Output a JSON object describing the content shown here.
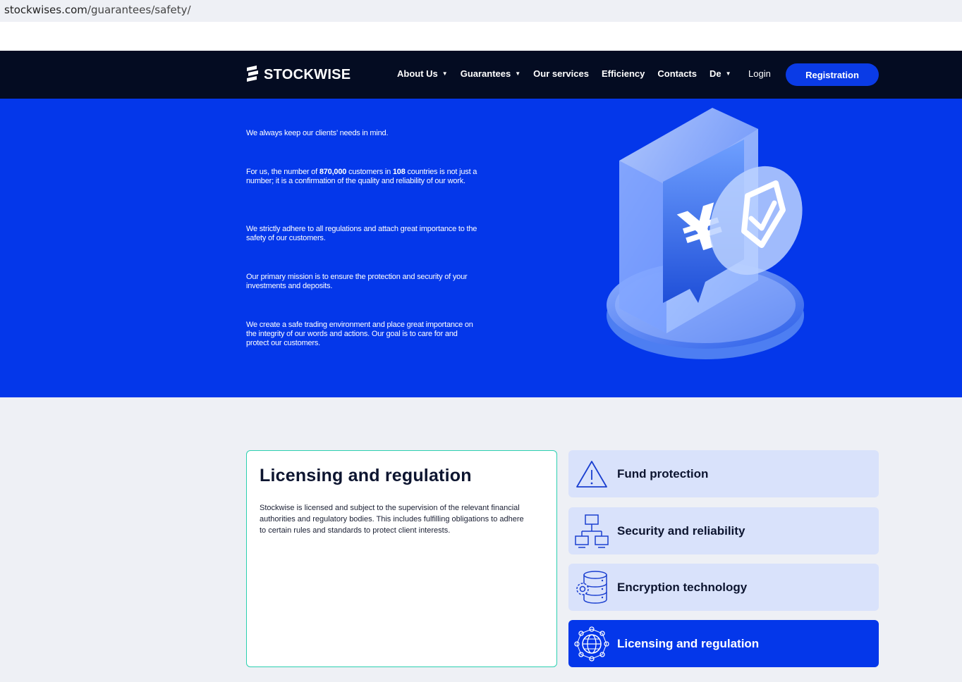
{
  "browser": {
    "url_host": "stockwises.com",
    "url_path": "/guarantees/safety/"
  },
  "nav": {
    "logo_text": "STOCKWISE",
    "items": [
      {
        "label": "About Us",
        "dropdown": true
      },
      {
        "label": "Guarantees",
        "dropdown": true
      },
      {
        "label": "Our services",
        "dropdown": false
      },
      {
        "label": "Efficiency",
        "dropdown": false
      },
      {
        "label": "Contacts",
        "dropdown": false
      },
      {
        "label": "De",
        "dropdown": true
      }
    ],
    "login": "Login",
    "register": "Registration"
  },
  "hero": {
    "p1": "We always keep our clients’ needs in mind.",
    "p2_a": "For us, the number of ",
    "p2_customers": "870,000",
    "p2_b": " customers in ",
    "p2_countries": "108",
    "p2_c": " countries is not just a number; it is a confirmation of the quality and reliability of our work.",
    "p3": "We strictly adhere to all regulations and attach great importance to the safety of our customers.",
    "p4": "Our primary mission is to ensure the protection and security of your investments and deposits.",
    "p5": "We create a safe trading environment and place great importance on the integrity of our words and actions. Our goal is to care for and protect our customers.",
    "illustration_icon": "yen-shield-illustration"
  },
  "detail": {
    "title": "Licensing and regulation",
    "body": "Stockwise is licensed and subject to the supervision of the relevant financial authorities and regulatory bodies. This includes fulfilling obligations to adhere to certain rules and standards to protect client interests."
  },
  "tabs": [
    {
      "label": "Fund protection",
      "icon": "warning-triangle-icon",
      "active": false
    },
    {
      "label": "Security and reliability",
      "icon": "network-icon",
      "active": false
    },
    {
      "label": "Encryption technology",
      "icon": "database-gear-icon",
      "active": false
    },
    {
      "label": "Licensing and regulation",
      "icon": "globe-network-icon",
      "active": true
    }
  ],
  "colors": {
    "brand_blue": "#0437ea",
    "nav_dark": "#040c22",
    "tab_bg": "#d9e2fb",
    "card_border": "#2cd0b0"
  }
}
